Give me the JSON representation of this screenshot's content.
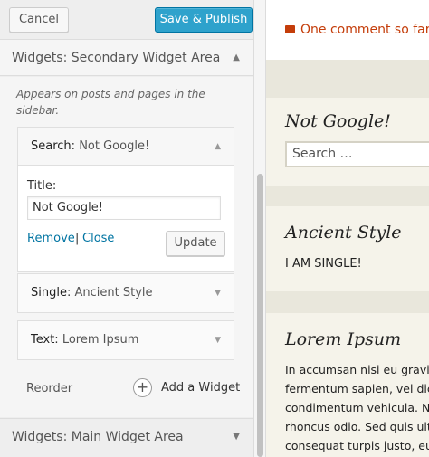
{
  "header": {
    "cancel_label": "Cancel",
    "publish_label": "Save & Publish"
  },
  "sections": {
    "secondary": {
      "title": "Widgets: Secondary Widget Area",
      "arrow": "▲"
    },
    "main": {
      "title": "Widgets: Main Widget Area",
      "arrow": "▼"
    }
  },
  "panel": {
    "description": "Appears on posts and pages in the sidebar.",
    "widgets": [
      {
        "name": "Search",
        "title": "Not Google!",
        "expanded": true
      },
      {
        "name": "Single",
        "title": "Ancient Style",
        "expanded": false
      },
      {
        "name": "Text",
        "title": "Lorem Ipsum",
        "expanded": false
      }
    ],
    "search_form": {
      "title_label": "Title:",
      "title_value": "Not Google!",
      "remove_label": "Remove",
      "separator": "|",
      "close_label": "Close",
      "update_label": "Update"
    },
    "reorder_label": "Reorder",
    "add_widget_label": "Add a Widget",
    "add_icon": "+",
    "chevron": "▼"
  },
  "preview": {
    "comment_link": "One comment so far",
    "search_widget": {
      "title": "Not Google!",
      "placeholder": "Search …"
    },
    "single_widget": {
      "title": "Ancient Style",
      "body": "I AM SINGLE!"
    },
    "text_widget": {
      "title": "Lorem Ipsum",
      "lines": [
        "In accumsan nisi eu gravi",
        "fermentum sapien, vel dic",
        "condimentum vehicula. Nu",
        "rhoncus odio. Sed quis ulti",
        "consequat turpis justo, eu"
      ]
    }
  },
  "colors": {
    "publish_bg": "#2ea2cc",
    "link": "#0074a2",
    "comment": "#c43d0a",
    "preview_bg": "#e9e7dc"
  }
}
